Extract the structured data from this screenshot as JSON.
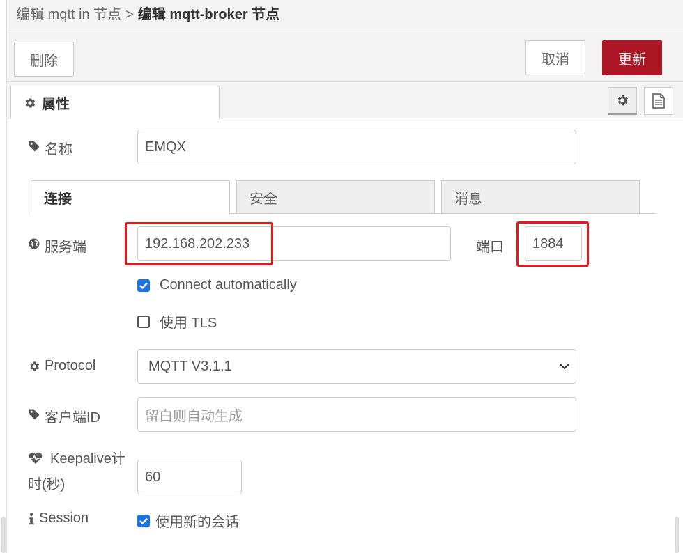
{
  "breadcrumb": {
    "parent": "编辑 mqtt in 节点",
    "separator": ">",
    "current": "编辑 mqtt-broker 节点"
  },
  "toolbar": {
    "delete_label": "删除",
    "cancel_label": "取消",
    "update_label": "更新"
  },
  "tabs": {
    "properties_label": "属性"
  },
  "form": {
    "name_label": "名称",
    "name_value": "EMQX",
    "subtabs": [
      "连接",
      "安全",
      "消息"
    ],
    "server_label": "服务端",
    "server_value": "192.168.202.233",
    "port_label": "端口",
    "port_value": "1884",
    "auto_connect_label": "Connect automatically",
    "auto_connect_checked": true,
    "tls_label": "使用 TLS",
    "tls_checked": false,
    "protocol_label": "Protocol",
    "protocol_value": "MQTT V3.1.1",
    "client_id_label": "客户端ID",
    "client_id_placeholder": "留白则自动生成",
    "keepalive_label_1": "Keepalive计",
    "keepalive_label_2": "时(秒)",
    "keepalive_value": "60",
    "session_label": "Session",
    "session_checkbox_label": "使用新的会话",
    "session_checked": true
  },
  "colors": {
    "primary": "#ad1625",
    "highlight": "#e81818",
    "checkbox": "#1a73e8"
  }
}
